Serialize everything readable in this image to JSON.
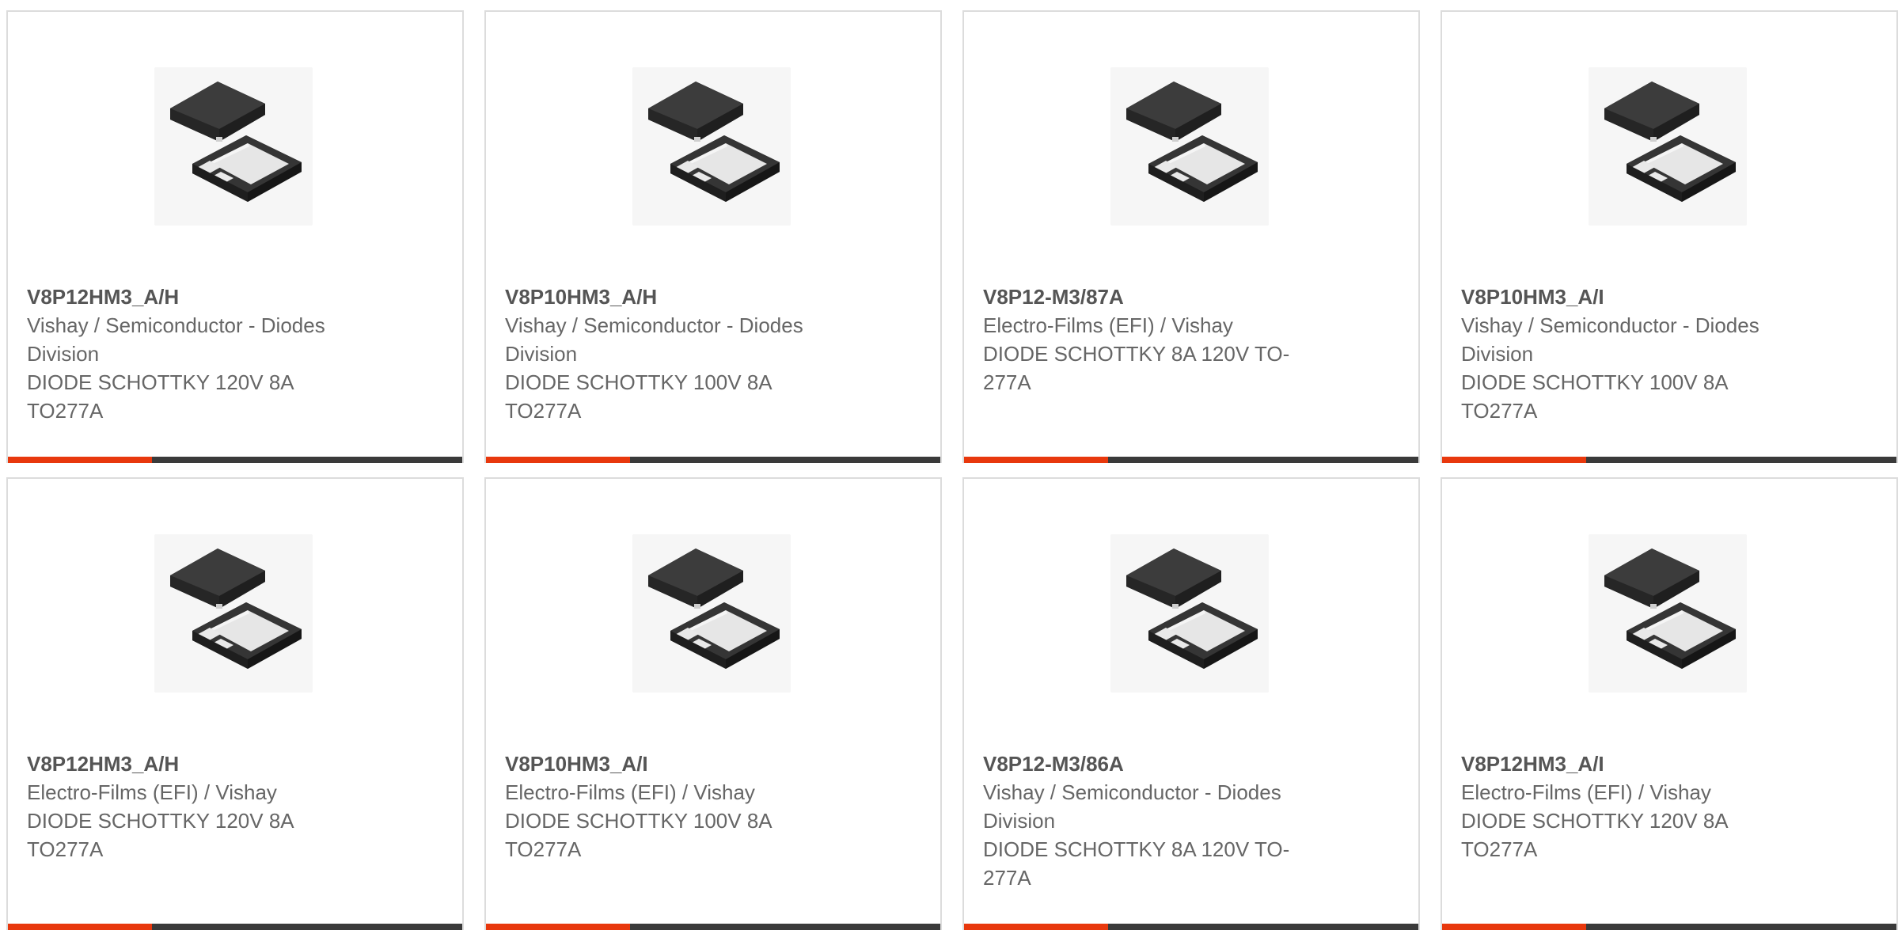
{
  "colors": {
    "accent": "#e8380d",
    "bar": "#3a3a3a",
    "border": "#dcdcdc",
    "text": "#666666",
    "title": "#555555"
  },
  "products": [
    {
      "part_number": "V8P12HM3_A/H",
      "manufacturer": "Vishay / Semiconductor - Diodes Division",
      "description": "DIODE SCHOTTKY 120V 8A TO277A",
      "image_icon": "diode-package-icon"
    },
    {
      "part_number": "V8P10HM3_A/H",
      "manufacturer": "Vishay / Semiconductor - Diodes Division",
      "description": "DIODE SCHOTTKY 100V 8A TO277A",
      "image_icon": "diode-package-icon"
    },
    {
      "part_number": "V8P12-M3/87A",
      "manufacturer": "Electro-Films (EFI) / Vishay",
      "description": "DIODE SCHOTTKY 8A 120V TO-277A",
      "image_icon": "diode-package-icon"
    },
    {
      "part_number": "V8P10HM3_A/I",
      "manufacturer": "Vishay / Semiconductor - Diodes Division",
      "description": "DIODE SCHOTTKY 100V 8A TO277A",
      "image_icon": "diode-package-icon"
    },
    {
      "part_number": "V8P12HM3_A/H",
      "manufacturer": "Electro-Films (EFI) / Vishay",
      "description": "DIODE SCHOTTKY 120V 8A TO277A",
      "image_icon": "diode-package-icon"
    },
    {
      "part_number": "V8P10HM3_A/I",
      "manufacturer": "Electro-Films (EFI) / Vishay",
      "description": "DIODE SCHOTTKY 100V 8A TO277A",
      "image_icon": "diode-package-icon"
    },
    {
      "part_number": "V8P12-M3/86A",
      "manufacturer": "Vishay / Semiconductor - Diodes Division",
      "description": "DIODE SCHOTTKY 8A 120V TO-277A",
      "image_icon": "diode-package-icon"
    },
    {
      "part_number": "V8P12HM3_A/I",
      "manufacturer": "Electro-Films (EFI) / Vishay",
      "description": "DIODE SCHOTTKY 120V 8A TO277A",
      "image_icon": "diode-package-icon"
    }
  ]
}
